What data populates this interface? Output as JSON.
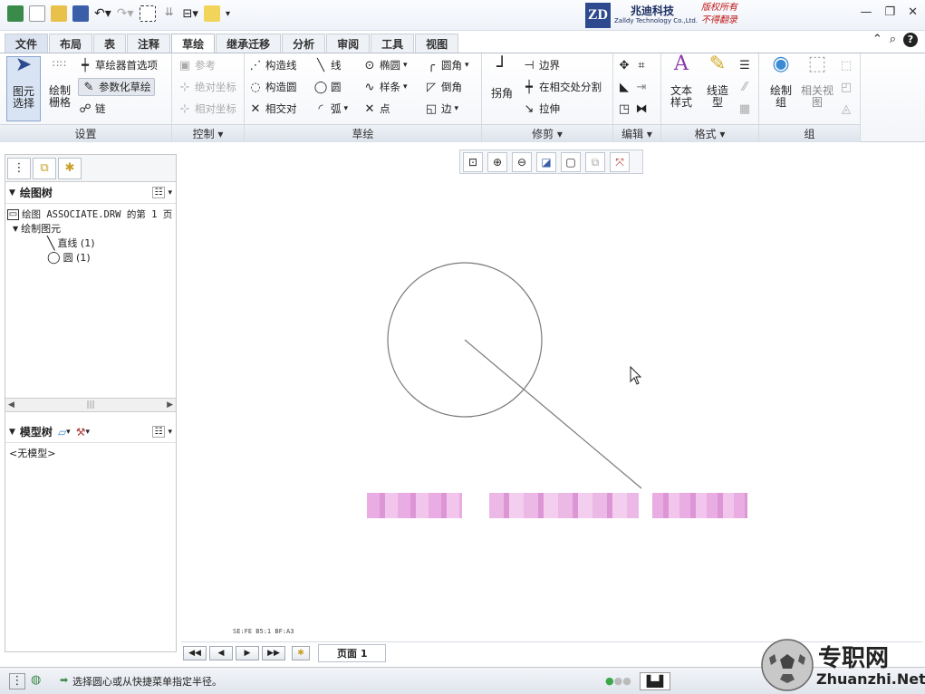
{
  "titlebar": {
    "logo": {
      "mark": "ZD",
      "company_cn": "兆迪科技",
      "company_en": "Zalldy Technology Co.,Ltd.",
      "rights1": "版权所有",
      "rights2": "不得翻录"
    },
    "window_controls": [
      "—",
      "❐",
      "✕"
    ]
  },
  "tabs": [
    "文件",
    "布局",
    "表",
    "注释",
    "草绘",
    "继承迁移",
    "分析",
    "审阅",
    "工具",
    "视图"
  ],
  "active_tab": "草绘",
  "ribbon": {
    "setup": {
      "label": "设置",
      "select": "图元\n选择",
      "grid": "绘制\n栅格",
      "prefs": "草绘器首选项",
      "param": "参数化草绘",
      "chain": "链"
    },
    "control": {
      "label": "控制",
      "ref": "参考",
      "abs": "绝对坐标",
      "rel": "相对坐标"
    },
    "sketch": {
      "label": "草绘",
      "construct_line": "构造线",
      "construct_circle": "构造圆",
      "intersect": "相交对",
      "line": "线",
      "circle": "圆",
      "arc": "弧",
      "ellipse": "椭圆",
      "spline": "样条",
      "point": "点",
      "fillet": "圆角",
      "chamfer": "倒角",
      "edge": "边"
    },
    "trim": {
      "label": "修剪",
      "corner": "拐角",
      "boundary": "边界",
      "divide": "在相交处分割",
      "stretch": "拉伸"
    },
    "edit": {
      "label": "编辑"
    },
    "format": {
      "label": "格式",
      "text_style": "文本\n样式",
      "line_style": "线造\n型"
    },
    "group": {
      "label": "组",
      "draw_group": "绘制\n组",
      "related_view": "相关视\n图"
    }
  },
  "drawing_tree": {
    "title": "绘图树",
    "root": "绘图 ASSOCIATE.DRW 的第 1 页",
    "folder": "绘制图元",
    "items": [
      "直线 (1)",
      "圆 (1)"
    ]
  },
  "model_tree": {
    "title": "模型树",
    "empty": "<无模型>"
  },
  "page_tab": "页面 1",
  "status_message": "选择圆心或从快捷菜单指定半径。",
  "canvas_info": "SE:FE  B5:1  BF:A3",
  "watermark": {
    "cn": "专职网",
    "en": "Zhuanzhi.Net"
  },
  "colors": {
    "accent": "#2e4a8e",
    "ribbon_bg": "#f3f5f9",
    "sketch_stroke": "#7a7a7a",
    "pixelated": "#e7a4e0"
  }
}
